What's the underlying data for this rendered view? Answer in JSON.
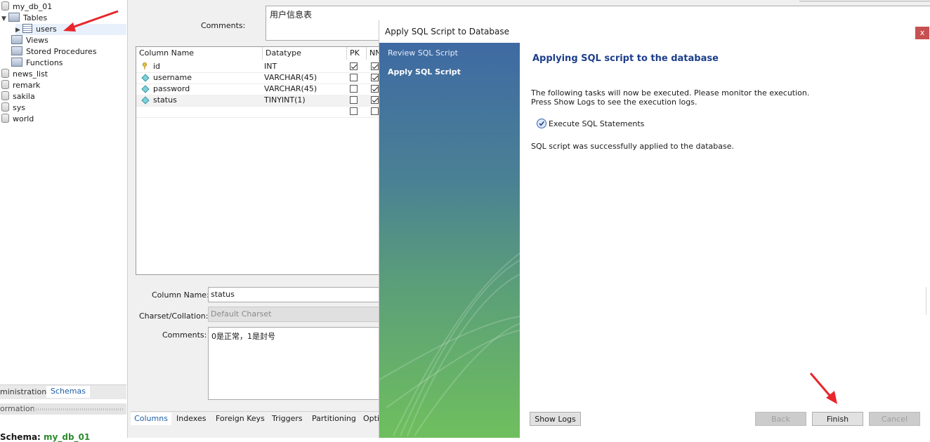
{
  "sidebar": {
    "tree": {
      "db_top": "my_db_01",
      "tables_label": "Tables",
      "table_users": "users",
      "views_label": "Views",
      "procs_label": "Stored Procedures",
      "funcs_label": "Functions",
      "db_news": "news_list",
      "db_remark": "remark",
      "db_sakila": "sakila",
      "db_sys": "sys",
      "db_world": "world"
    },
    "tabs": {
      "admin": "ministration",
      "schemas": "Schemas"
    },
    "info_label": "ormation",
    "schema_prefix": "Schema:",
    "schema_value": "my_db_01"
  },
  "editor": {
    "comments_label": "Comments:",
    "comments_value": "用户信息表",
    "grid": {
      "headers": [
        "Column Name",
        "Datatype",
        "PK",
        "NN"
      ],
      "rows": [
        {
          "name": "id",
          "type": "INT",
          "pk": true,
          "nn": true
        },
        {
          "name": "username",
          "type": "VARCHAR(45)",
          "pk": false,
          "nn": true
        },
        {
          "name": "password",
          "type": "VARCHAR(45)",
          "pk": false,
          "nn": true
        },
        {
          "name": "status",
          "type": "TINYINT(1)",
          "pk": false,
          "nn": true
        }
      ]
    },
    "detail": {
      "col_name_label": "Column Name:",
      "col_name_value": "status",
      "charset_label": "Charset/Collation:",
      "charset_value": "Default Charset",
      "comments_label": "Comments:",
      "comments_value": "0是正常，1是封号"
    },
    "bottom_tabs": [
      "Columns",
      "Indexes",
      "Foreign Keys",
      "Triggers",
      "Partitioning",
      "Opti"
    ]
  },
  "dialog": {
    "title": "Apply SQL Script to Database",
    "close": "x",
    "steps": [
      "Review SQL Script",
      "Apply SQL Script"
    ],
    "heading": "Applying SQL script to the database",
    "desc_line1": "The following tasks will now be executed. Please monitor the execution.",
    "desc_line2": "Press Show Logs to see the execution logs.",
    "task": "Execute SQL Statements",
    "result": "SQL script was successfully applied to the database.",
    "buttons": {
      "show_logs": "Show Logs",
      "back": "Back",
      "finish": "Finish",
      "cancel": "Cancel"
    }
  },
  "colors": {
    "accent": "#1e3f8a",
    "arrow": "#e8262c",
    "tab_active": "#1e5fa8"
  }
}
